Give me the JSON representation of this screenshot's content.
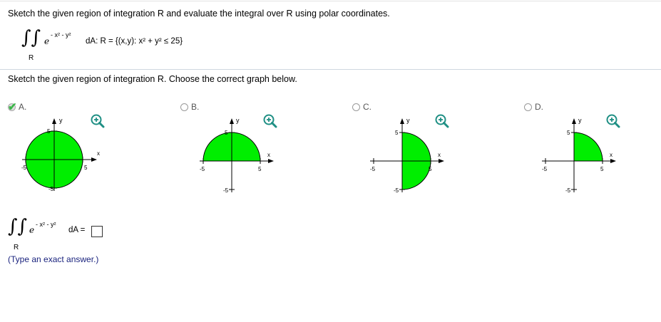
{
  "question": {
    "text": "Sketch the given region of integration R and evaluate the integral over R using polar coordinates.",
    "integrand_base": "e",
    "integrand_exponent": "- x² - y²",
    "region_text": "dA: R = {(x,y): x² + y² ≤ 25}",
    "region_label": "R"
  },
  "instruction": "Sketch the given region of integration R. Choose the correct graph below.",
  "options": [
    {
      "letter": "A.",
      "selected": true,
      "shape": "full-circle",
      "axis_labels": {
        "y": "y",
        "x": "x",
        "pos": "5",
        "neg": "-5",
        "top": "5",
        "bottom": "-5"
      }
    },
    {
      "letter": "B.",
      "selected": false,
      "shape": "upper-half",
      "axis_labels": {
        "y": "y",
        "x": "x",
        "pos": "5",
        "neg": "-5",
        "top": "5",
        "bottom": "-5"
      }
    },
    {
      "letter": "C.",
      "selected": false,
      "shape": "right-half",
      "axis_labels": {
        "y": "y",
        "x": "x",
        "pos": "5",
        "neg": "-5",
        "top": "5",
        "bottom": "-5"
      }
    },
    {
      "letter": "D.",
      "selected": false,
      "shape": "quarter",
      "axis_labels": {
        "y": "y",
        "x": "x",
        "pos": "5",
        "neg": "-5",
        "top": "5",
        "bottom": "-5"
      }
    }
  ],
  "answer": {
    "integrand_base": "e",
    "integrand_exponent": "- x² - y²",
    "suffix": "dA =",
    "region_label": "R",
    "value": "",
    "hint": "(Type an exact answer.)"
  },
  "colors": {
    "region_fill": "#00ee00",
    "check": "#3cb64a",
    "zoom_icon": "#1f8f84",
    "hint_text": "#1a237e"
  }
}
